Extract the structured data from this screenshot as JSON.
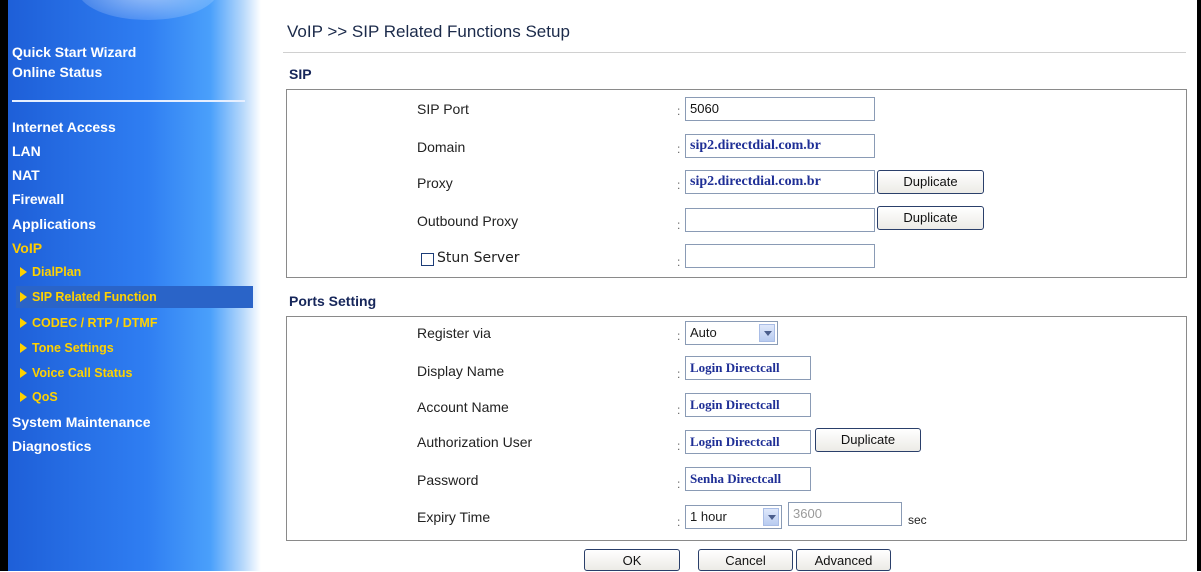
{
  "sidebar": {
    "items": [
      {
        "label": "Quick Start Wizard"
      },
      {
        "label": "Online Status"
      },
      {
        "label": "Internet Access"
      },
      {
        "label": "LAN"
      },
      {
        "label": "NAT"
      },
      {
        "label": "Firewall"
      },
      {
        "label": "Applications"
      },
      {
        "label": "VoIP"
      },
      {
        "label": "System Maintenance"
      },
      {
        "label": "Diagnostics"
      }
    ],
    "voip_sub": [
      {
        "label": "DialPlan"
      },
      {
        "label": "SIP Related Function"
      },
      {
        "label": "CODEC / RTP / DTMF"
      },
      {
        "label": "Tone Settings"
      },
      {
        "label": "Voice Call Status"
      },
      {
        "label": "QoS"
      }
    ]
  },
  "page": {
    "title": "VoIP >> SIP Related Functions Setup"
  },
  "sip": {
    "section_title": "SIP",
    "sip_port": {
      "label": "SIP Port",
      "value": "5060"
    },
    "domain": {
      "label": "Domain",
      "value": "sip2.directdial.com.br"
    },
    "proxy": {
      "label": "Proxy",
      "value": "sip2.directdial.com.br",
      "button": "Duplicate"
    },
    "outbound_proxy": {
      "label": "Outbound Proxy",
      "value": "",
      "button": "Duplicate"
    },
    "stun": {
      "label": "Stun Server",
      "value": "",
      "checked": false
    }
  },
  "ports": {
    "section_title": "Ports Setting",
    "register_via": {
      "label": "Register via",
      "value": "Auto"
    },
    "display_name": {
      "label": "Display Name",
      "value": "Login Directcall"
    },
    "account_name": {
      "label": "Account Name",
      "value": "Login Directcall"
    },
    "authorization_user": {
      "label": "Authorization User",
      "value": "Login Directcall",
      "button": "Duplicate"
    },
    "password": {
      "label": "Password",
      "value": "Senha Directcall"
    },
    "expiry": {
      "label": "Expiry Time",
      "value": "1 hour",
      "seconds": "3600",
      "unit": "sec"
    }
  },
  "buttons": {
    "ok": "OK",
    "cancel": "Cancel",
    "advanced": "Advanced"
  },
  "colon": ":"
}
